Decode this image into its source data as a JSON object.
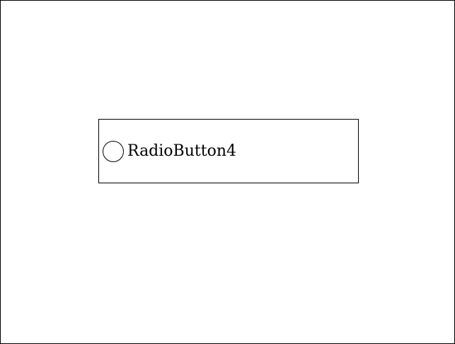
{
  "window": {
    "background": "#ffffff",
    "border_color": "#000000"
  },
  "radio_button": {
    "label": "RadioButton4",
    "checked": false
  }
}
